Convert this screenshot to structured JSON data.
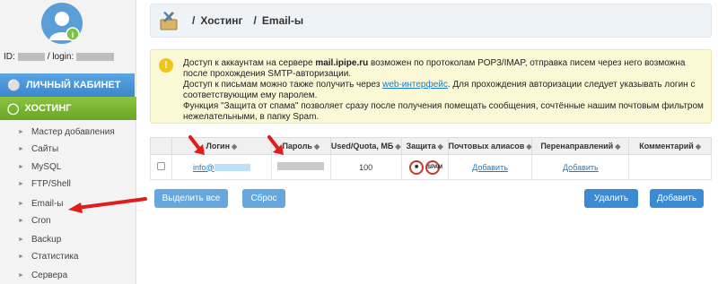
{
  "sidebar": {
    "id_prefix": "ID:",
    "login_prefix": "/ login:",
    "menu_main": [
      {
        "label": "ЛИЧНЫЙ КАБИНЕТ",
        "icon": "person-icon"
      },
      {
        "label": "ХОСТИНГ",
        "icon": "hosting-icon"
      }
    ],
    "items": [
      {
        "label": "Мастер добавления"
      },
      {
        "label": "Сайты"
      },
      {
        "label": "MySQL"
      },
      {
        "label": "FTP/Shell"
      },
      {
        "label": "Email-ы"
      },
      {
        "label": "Cron"
      },
      {
        "label": "Backup"
      },
      {
        "label": "Статистика"
      },
      {
        "label": "Сервера"
      }
    ]
  },
  "breadcrumb": {
    "sep": "/",
    "items": [
      "Хостинг",
      "Email-ы"
    ]
  },
  "info": {
    "p1_before": "Доступ к аккаунтам на сервере ",
    "p1_server": "mail.ipipe.ru",
    "p1_after": " возможен по протоколам POP3/IMAP, отправка писем через него возможна после прохождения SMTP-авторизации.",
    "p2_before": "Доступ к письмам можно также получить через ",
    "p2_link": "web-интерфейс",
    "p2_after": ". Для прохождения авторизации следует указывать логин с соответствующим ему паролем.",
    "p3": "Функция \"Защита от спама\" позволяет сразу после получения помещать сообщения, сочтённые нашим почтовым фильтром нежелательными, в папку Spam."
  },
  "table": {
    "headers": [
      "Логин",
      "Пароль",
      "Used/Quota, МБ",
      "Защита",
      "Почтовых алиасов",
      "Перенаправлений",
      "Комментарий"
    ],
    "row": {
      "login": "info@",
      "quota": "100",
      "aliases": "Добавить",
      "redirects": "Добавить",
      "comment": ""
    },
    "protect_icons": [
      "virus-icon",
      "spam-icon"
    ],
    "protect_spam_text": "SPAM"
  },
  "buttons": {
    "select_all": "Выделить все",
    "reset": "Сброс",
    "delete": "Удалить",
    "add": "Добавить"
  },
  "colors": {
    "lk_blue": "#4a96d9",
    "hosting_green": "#78b32e",
    "button_blue": "#3b8ad3",
    "arrow_red": "#e21b1b"
  }
}
